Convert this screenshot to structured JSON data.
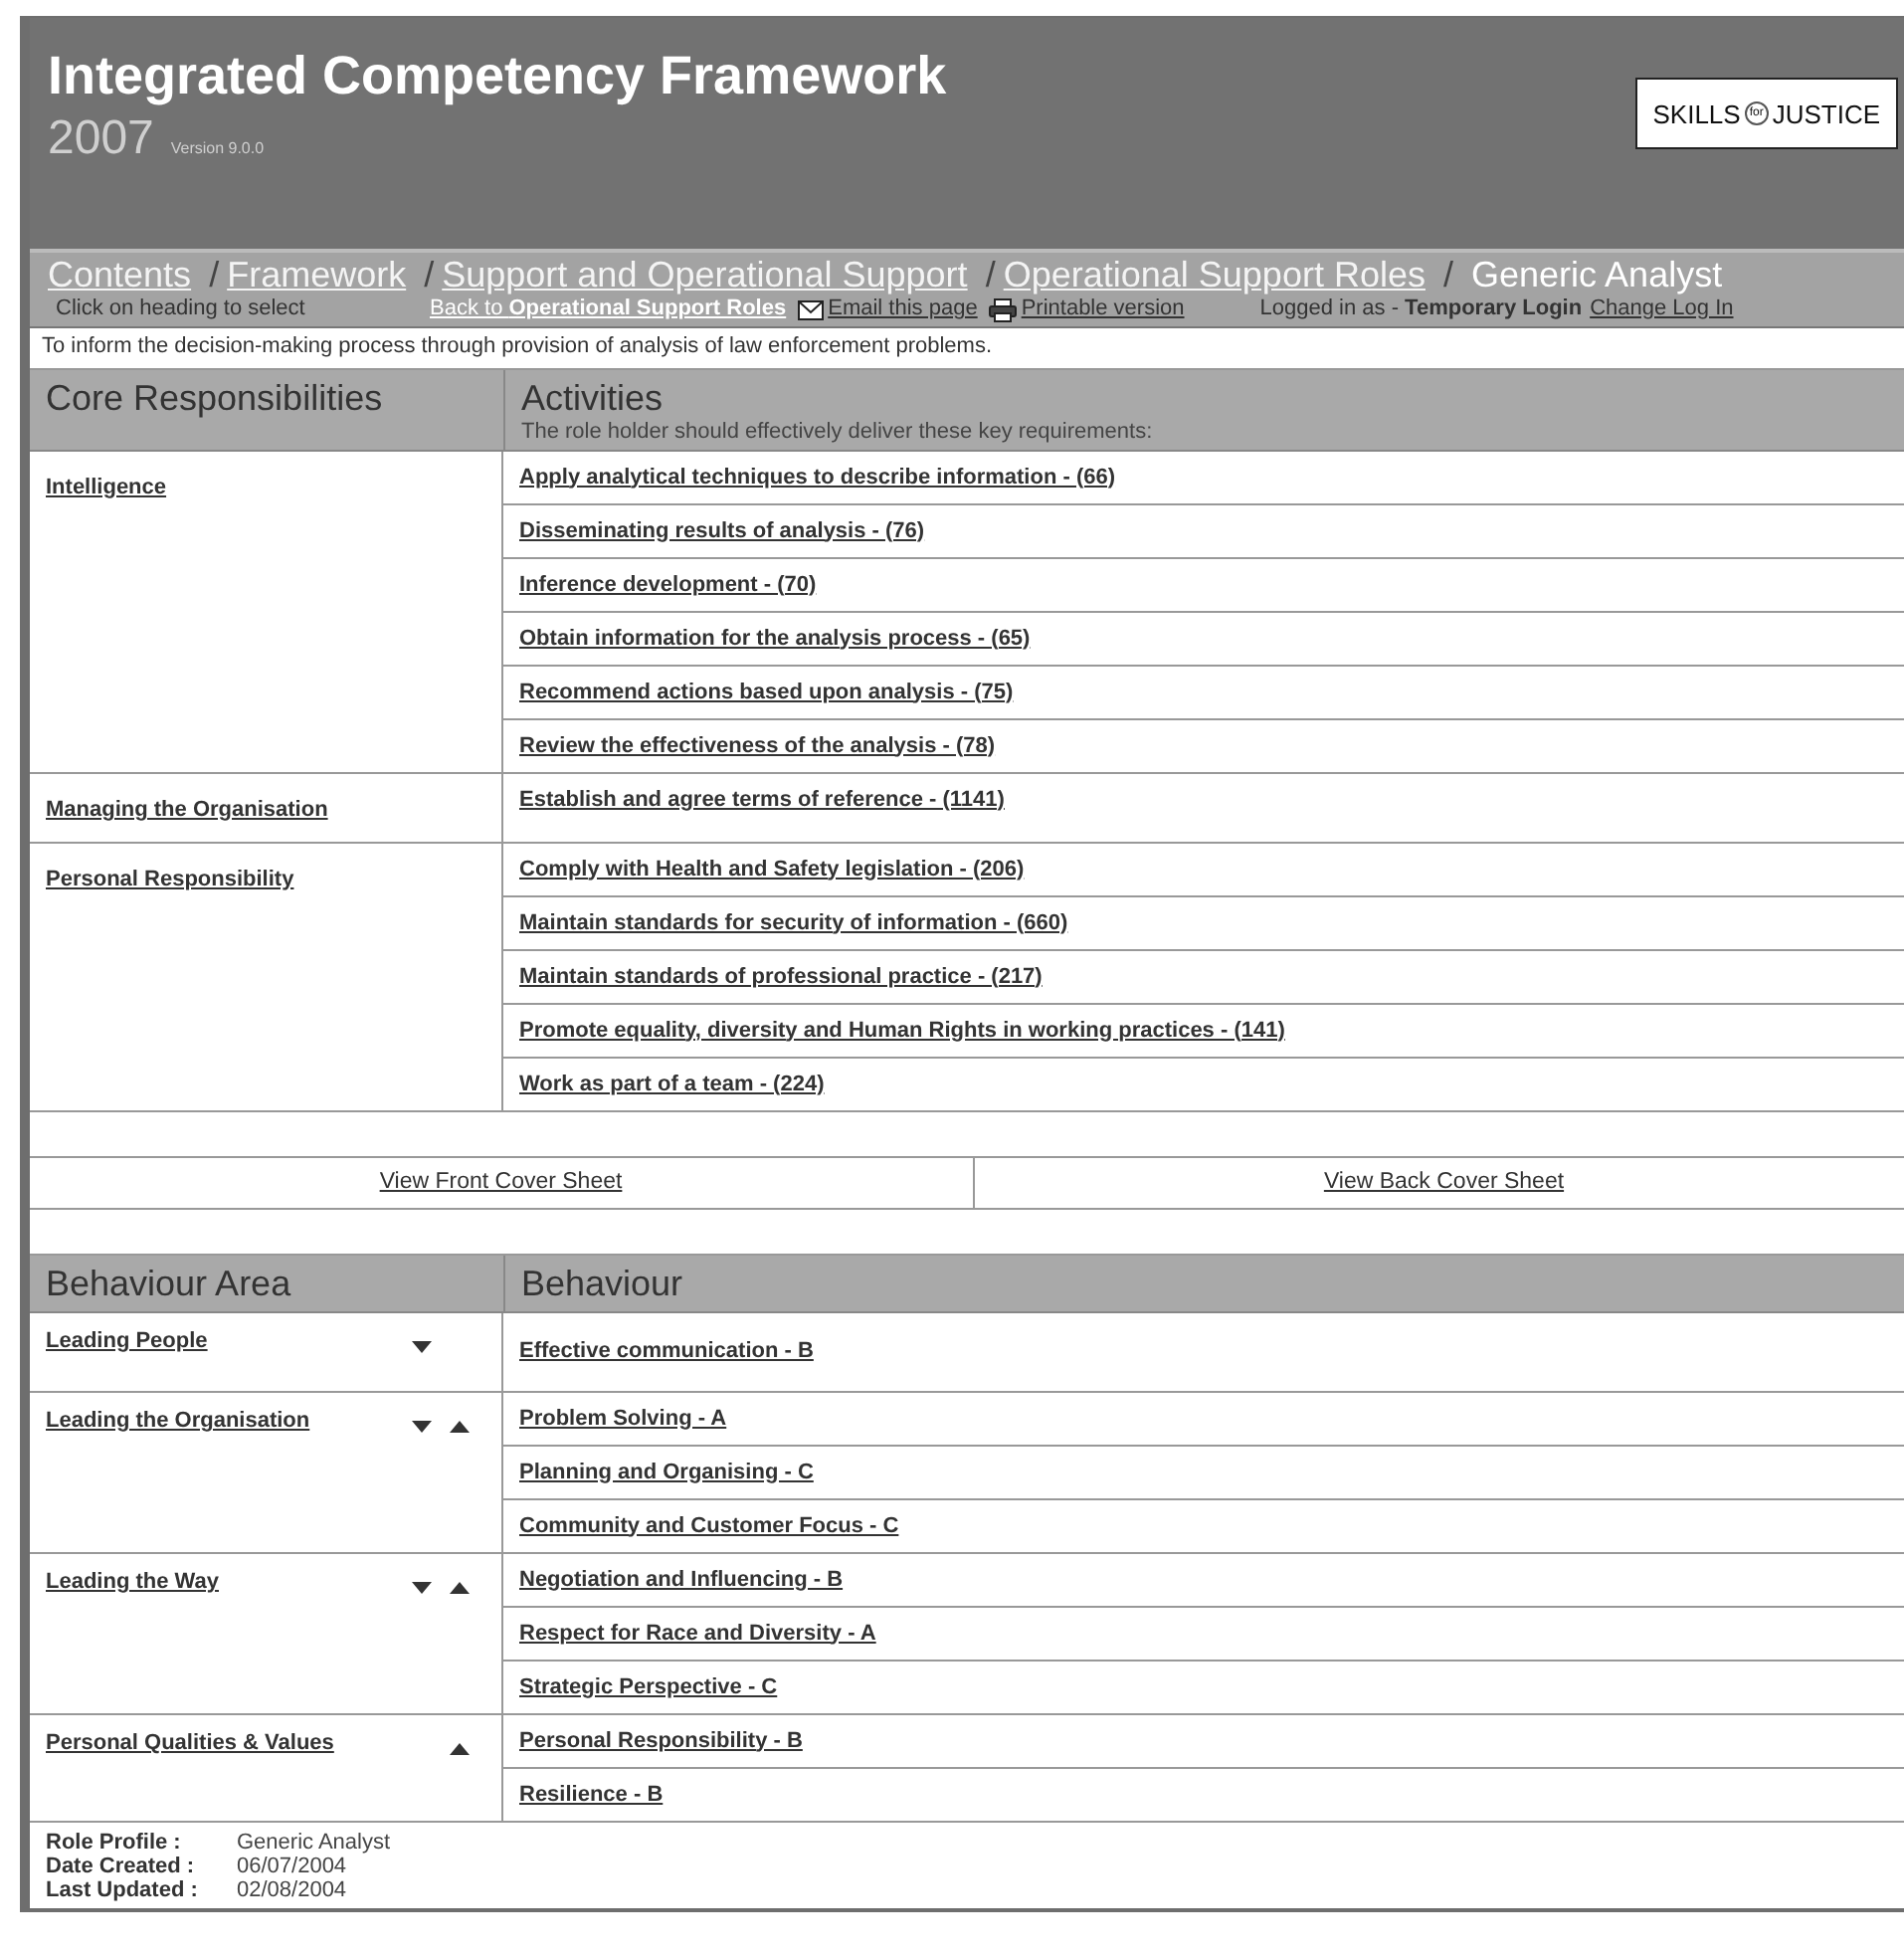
{
  "header": {
    "title": "Integrated Competency Framework",
    "year": "2007",
    "version": "Version 9.0.0",
    "logo": {
      "left": "SKILLS",
      "middle": "for",
      "right": "JUSTICE"
    }
  },
  "breadcrumb": {
    "links": [
      "Contents",
      "Framework",
      "Support and Operational Support",
      "Operational Support Roles"
    ],
    "separator": "/",
    "current": "Generic Analyst"
  },
  "toolbar": {
    "hint": "Click on heading to select",
    "back_link": "Back to **Operational Support Roles**",
    "email_link": "Email this page",
    "print_link": "Printable version",
    "login_label": "Logged in as - **Temporary Login**",
    "change_login": "Change Log In"
  },
  "description": "To inform the decision-making process through provision of analysis of law enforcement problems.",
  "core_table": {
    "columns": [
      "Core Responsibilities",
      "Activities"
    ],
    "activities_subtitle": "The role holder should effectively deliver these key requirements:",
    "groups": [
      {
        "name": "Intelligence",
        "items": [
          "Apply analytical techniques to describe information - (66)",
          "Disseminating results of analysis - (76)",
          "Inference development - (70)",
          "Obtain information for the analysis process - (65)",
          "Recommend actions based upon analysis - (75)",
          "Review the effectiveness of the analysis - (78)"
        ]
      },
      {
        "name": "Managing the Organisation",
        "items": [
          "Establish and agree terms of reference - (1141)"
        ]
      },
      {
        "name": "Personal Responsibility",
        "items": [
          "Comply with Health and Safety legislation - (206)",
          "Maintain standards for security of information - (660)",
          "Maintain standards of professional practice - (217)",
          "Promote equality, diversity and Human Rights in working practices - (141)",
          "Work as part of a team - (224)"
        ]
      }
    ]
  },
  "cover_sheets": [
    "View Front Cover Sheet",
    "View Back Cover Sheet"
  ],
  "behaviour_table": {
    "columns": [
      "Behaviour Area",
      "Behaviour"
    ],
    "groups": [
      {
        "name": "Leading People",
        "move_down": true,
        "move_up": false,
        "items": [
          "Effective communication - B"
        ]
      },
      {
        "name": "Leading the Organisation",
        "move_down": true,
        "move_up": true,
        "items": [
          "Problem Solving - A",
          "Planning and Organising - C",
          "Community and Customer Focus - C"
        ]
      },
      {
        "name": "Leading the Way",
        "move_down": true,
        "move_up": true,
        "items": [
          "Negotiation and Influencing - B",
          "Respect for Race and Diversity - A",
          "Strategic Perspective - C"
        ]
      },
      {
        "name": "Personal Qualities & Values",
        "move_down": false,
        "move_up": true,
        "items": [
          "Personal Responsibility - B",
          "Resilience - B"
        ]
      }
    ]
  },
  "footer": [
    {
      "label": "Role Profile :",
      "value": "Generic Analyst"
    },
    {
      "label": "Date Created :",
      "value": "06/07/2004"
    },
    {
      "label": "Last Updated :",
      "value": "02/08/2004"
    }
  ]
}
